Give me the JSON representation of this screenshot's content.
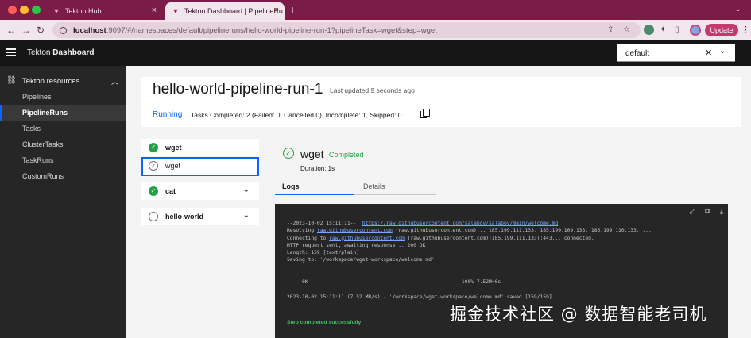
{
  "browser": {
    "tabs": [
      {
        "title": "Tekton Hub"
      },
      {
        "title": "Tekton Dashboard | PipelineRu"
      }
    ],
    "url_host": "localhost",
    "url_rest": ":9097/#/namespaces/default/pipelineruns/hello-world-pipeline-run-1?pipelineTask=wget&step=wget",
    "update_label": "Update"
  },
  "header": {
    "brand_light": "Tekton",
    "brand_bold": "Dashboard",
    "namespace": "default"
  },
  "sidebar": {
    "section_title": "Tekton resources",
    "items": [
      {
        "label": "Pipelines"
      },
      {
        "label": "PipelineRuns"
      },
      {
        "label": "Tasks"
      },
      {
        "label": "ClusterTasks"
      },
      {
        "label": "TaskRuns"
      },
      {
        "label": "CustomRuns"
      }
    ]
  },
  "run": {
    "title": "hello-world-pipeline-run-1",
    "last_updated": "Last updated 9 seconds ago",
    "status": "Running",
    "tasks_summary": "Tasks Completed: 2 (Failed: 0, Cancelled 0), Incomplete: 1, Skipped: 0"
  },
  "tasks": [
    {
      "name": "wget"
    },
    {
      "name": "wget"
    },
    {
      "name": "cat"
    },
    {
      "name": "hello-world"
    }
  ],
  "step": {
    "name": "wget",
    "status": "Completed",
    "duration": "Duration: 1s",
    "tabs": {
      "logs": "Logs",
      "details": "Details"
    }
  },
  "log": {
    "lines": [
      {
        "text": "--2023-10-02 15:11:11--  ",
        "link": "https://raw.githubusercontent.com/salaboy/salaboy/main/welcome.md",
        "tail": ""
      },
      {
        "text": "Resolving ",
        "link": "raw.githubusercontent.com",
        "tail": " (raw.githubusercontent.com)... 185.199.111.133, 185.199.109.133, 185.199.110.133, ..."
      },
      {
        "text": "Connecting to ",
        "link": "raw.githubusercontent.com",
        "tail": " (raw.githubusercontent.com)|185.199.111.133|:443... connected."
      },
      {
        "text": "HTTP request sent, awaiting response... 200 OK",
        "link": "",
        "tail": ""
      },
      {
        "text": "Length: 159 [text/plain]",
        "link": "",
        "tail": ""
      },
      {
        "text": "Saving to: '/workspace/wget-workspace/welcome.md'",
        "link": "",
        "tail": ""
      },
      {
        "text": "",
        "link": "",
        "tail": ""
      },
      {
        "text": "",
        "link": "",
        "tail": ""
      },
      {
        "text": "     0K                                                   100% 7.52M=0s",
        "link": "",
        "tail": ""
      },
      {
        "text": "",
        "link": "",
        "tail": ""
      },
      {
        "text": "2023-10-02 15:11:11 (7.52 MB/s) - '/workspace/wget-workspace/welcome.md' saved [159/159]",
        "link": "",
        "tail": ""
      }
    ],
    "success": "Step completed successfully"
  },
  "watermark": "掘金技术社区 @ 数据智能老司机",
  "colors": {
    "chrome": "#7a1c47",
    "header": "#161616",
    "sidebar": "#262626",
    "accent": "#0f62fe",
    "success": "#24a148"
  }
}
